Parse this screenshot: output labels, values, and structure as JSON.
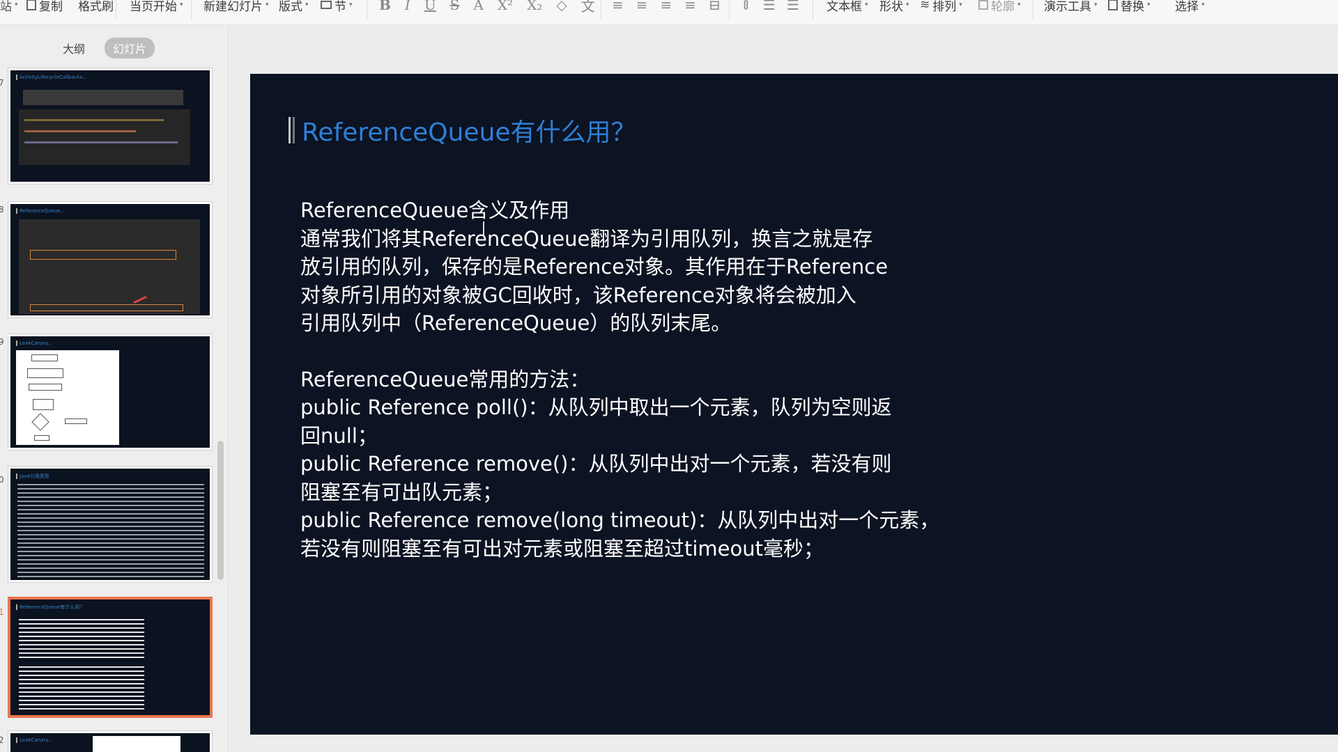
{
  "toolbar": {
    "copy": "复制",
    "format_painter": "格式刷",
    "from_current": "当页开始",
    "new_slide": "新建幻灯片",
    "layout": "版式",
    "section": "节",
    "textbox": "文本框",
    "shape": "形状",
    "arrange": "排列",
    "outline": "轮廓",
    "present_tools": "演示工具",
    "replace": "替换",
    "select": "选择"
  },
  "left_panel": {
    "tab_outline": "大纲",
    "tab_slides": "幻灯片",
    "thumbs": [
      {
        "num": "7",
        "title": "ActivityLifecycleCallbacks..."
      },
      {
        "num": "8",
        "title": "ReferenceQueue..."
      },
      {
        "num": "9",
        "title": "LeakCanary..."
      },
      {
        "num": "0",
        "title": "Java引用类型"
      },
      {
        "num": "1",
        "title": "ReferenceQueue有什么用？"
      },
      {
        "num": "2",
        "title": "LeakCanary..."
      }
    ]
  },
  "slide": {
    "title": "ReferenceQueue有什么用？",
    "lines": [
      "ReferenceQueue含义及作用",
      "通常我们将其ReferenceQueue翻译为引用队列，换言之就是存",
      "放引用的队列，保存的是Reference对象。其作用在于Reference",
      "对象所引用的对象被GC回收时，该Reference对象将会被加入",
      "引用队列中（ReferenceQueue）的队列末尾。",
      "ReferenceQueue常用的方法：",
      "public Reference poll()：从队列中取出一个元素，队列为空则返",
      "回null；",
      "public Reference remove()：从队列中出对一个元素，若没有则",
      "阻塞至有可出队元素；",
      "public Reference remove(long timeout)：从队列中出对一个元素，",
      "若没有则阻塞至有可出对元素或阻塞至超过timeout毫秒；"
    ]
  }
}
